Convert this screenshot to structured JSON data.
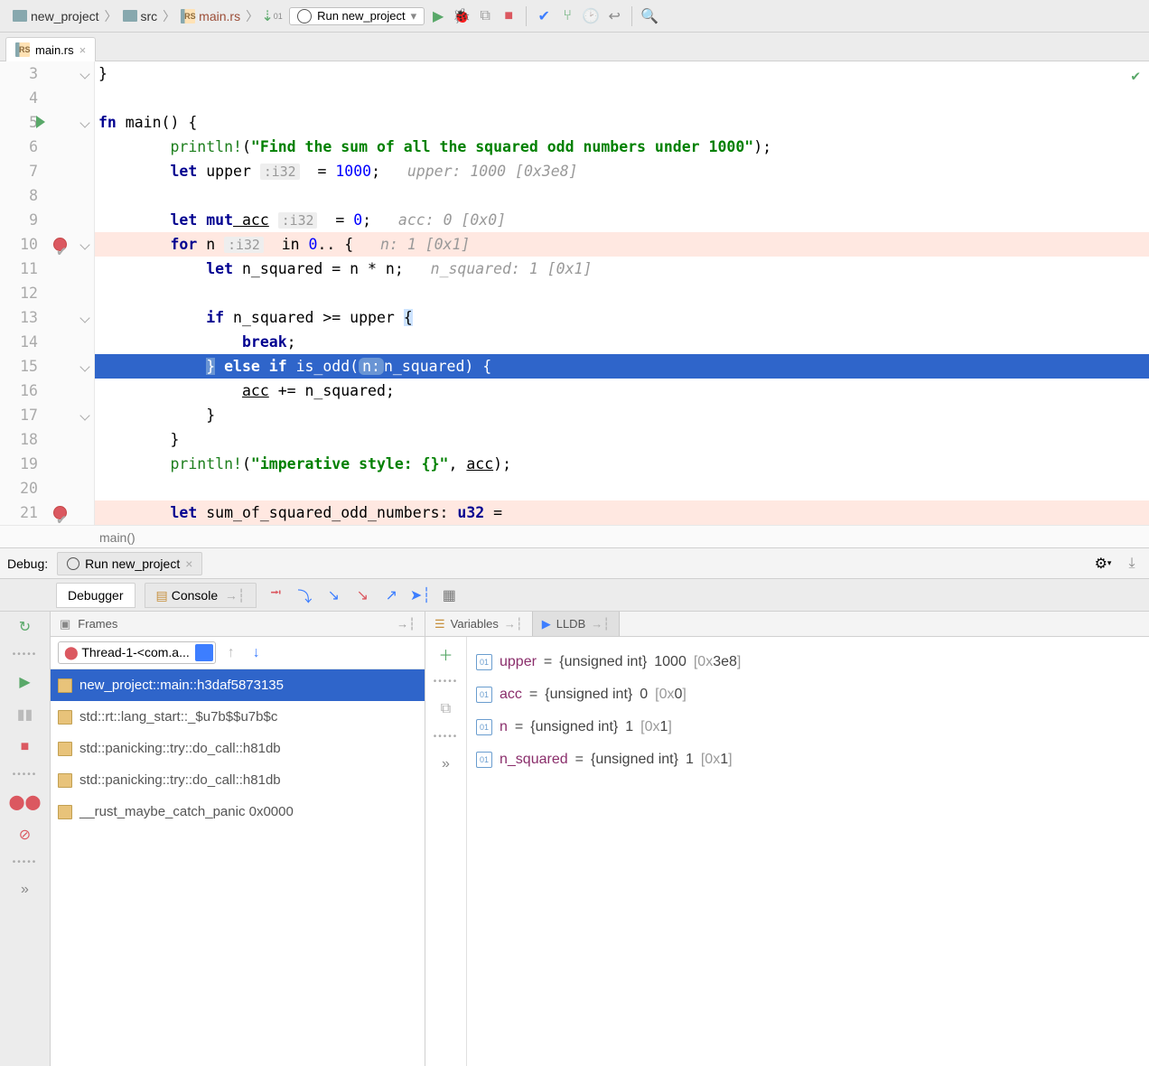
{
  "breadcrumb": {
    "project": "new_project",
    "folder": "src",
    "file": "main.rs"
  },
  "runConfig": {
    "label": "Run new_project"
  },
  "editorTabs": [
    {
      "label": "main.rs"
    }
  ],
  "code": {
    "lines": [
      3,
      4,
      5,
      6,
      7,
      8,
      9,
      10,
      11,
      12,
      13,
      14,
      15,
      16,
      17,
      18,
      19,
      20,
      21
    ],
    "l3": "}",
    "l5": {
      "kw": "fn",
      "rest": " main() {"
    },
    "l6": {
      "i": "        ",
      "mac": "println!",
      "paren": "(",
      "str": "\"Find the sum of all the squared odd numbers under 1000\"",
      "close": ");"
    },
    "l7": {
      "i": "        ",
      "kw": "let",
      "id": " upper",
      "tp": ":i32",
      "eq": "  = ",
      "num": "1000",
      "semi": ";",
      "hint": "   upper: 1000 [0x3e8]"
    },
    "l9": {
      "i": "        ",
      "kw": "let mut",
      "id": " acc",
      "tp": ":i32",
      "eq": "  = ",
      "num": "0",
      "semi": ";",
      "hint": "   acc: 0 [0x0]"
    },
    "l10": {
      "i": "        ",
      "kw": "for",
      "id": " n",
      "tp": ":i32",
      "mid": "  in ",
      "num": "0",
      "rest": ".. {",
      "hint": "   n: 1 [0x1]"
    },
    "l11": {
      "i": "            ",
      "kw": "let",
      "rest": " n_squared = n * n;",
      "hint": "   n_squared: 1 [0x1]"
    },
    "l13": {
      "i": "            ",
      "kw": "if",
      "rest": " n_squared >= upper ",
      "brace": "{"
    },
    "l14": {
      "i": "                ",
      "kw": "break",
      "rest": ";"
    },
    "l15": {
      "i": "            ",
      "close": "}",
      "kw": " else if ",
      "fn": "is_odd(",
      "param": "n:",
      "arg": "n_squared) {"
    },
    "l16": {
      "i": "                ",
      "id": "acc",
      "rest": " += n_squared;"
    },
    "l17": "            }",
    "l18": "        }",
    "l19": {
      "i": "        ",
      "mac": "println!",
      "paren": "(",
      "str": "\"imperative style: {}\"",
      "mid": ", ",
      "id": "acc",
      "close": ");"
    },
    "l21": {
      "i": "        ",
      "kw": "let",
      "id": " sum_of_squared_odd_numbers: ",
      "tp2": "u32",
      "rest": " ="
    },
    "breadcrumb": "main()"
  },
  "debug": {
    "labelDebug": "Debug:",
    "tabLabel": "Run new_project",
    "tabs": {
      "debugger": "Debugger",
      "console": "Console"
    },
    "frames": {
      "title": "Frames",
      "thread": "Thread-1-<com.a...",
      "rows": [
        "new_project::main::h3daf5873135",
        "std::rt::lang_start::_$u7b$$u7b$c",
        "std::panicking::try::do_call::h81db",
        "std::panicking::try::do_call::h81db",
        "__rust_maybe_catch_panic 0x0000"
      ]
    },
    "vars": {
      "title": "Variables",
      "lldb": "LLDB",
      "rows": [
        {
          "name": "upper",
          "type": "{unsigned int}",
          "val": "1000",
          "hex": "[0x3e8]"
        },
        {
          "name": "acc",
          "type": "{unsigned int}",
          "val": "0",
          "hex": "[0x0]"
        },
        {
          "name": "n",
          "type": "{unsigned int}",
          "val": "1",
          "hex": "[0x1]"
        },
        {
          "name": "n_squared",
          "type": "{unsigned int}",
          "val": "1",
          "hex": "[0x1]"
        }
      ]
    }
  },
  "moreSymbol": "»"
}
